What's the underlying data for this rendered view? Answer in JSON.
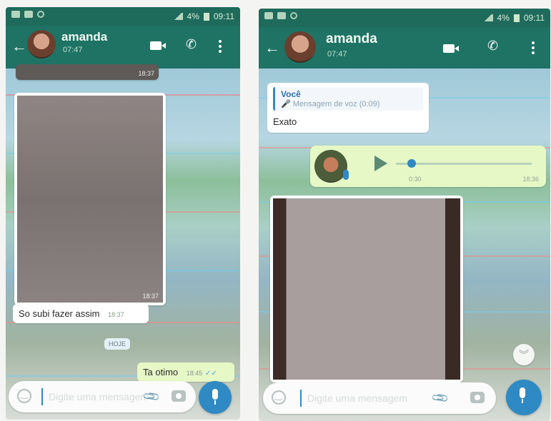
{
  "left": {
    "status": {
      "battery": "4%",
      "time": "09:11"
    },
    "header": {
      "contact_name": "amanda",
      "last_seen": "07:47"
    },
    "messages": {
      "top_image_time": "18:37",
      "image_time": "18:37",
      "text_message": "So subi fazer assim",
      "text_message_time": "18:37",
      "date_chip": "HOJE",
      "outgoing_text": "Ta otimo",
      "outgoing_time": "18:45"
    },
    "input": {
      "placeholder": "Digite uma mensagem"
    }
  },
  "right": {
    "status": {
      "battery": "4%",
      "time": "09:11"
    },
    "header": {
      "contact_name": "amanda",
      "last_seen": "07:47"
    },
    "messages": {
      "quote_author": "Você",
      "quote_text": "🎤 Mensagem de voz (0:09)",
      "reply_text": "Exato",
      "voice_duration": "0:30",
      "voice_time": "18:36"
    },
    "input": {
      "placeholder": "Digite uma mensagem"
    }
  },
  "colors": {
    "header": "#1e7364",
    "accent": "#2f8ac4",
    "outgoing_bubble": "#e7f8c7"
  },
  "icons": [
    "back-arrow-icon",
    "video-call-icon",
    "phone-icon",
    "menu-icon",
    "emoji-icon",
    "attach-icon",
    "camera-icon",
    "mic-icon",
    "play-icon",
    "scroll-down-icon"
  ]
}
